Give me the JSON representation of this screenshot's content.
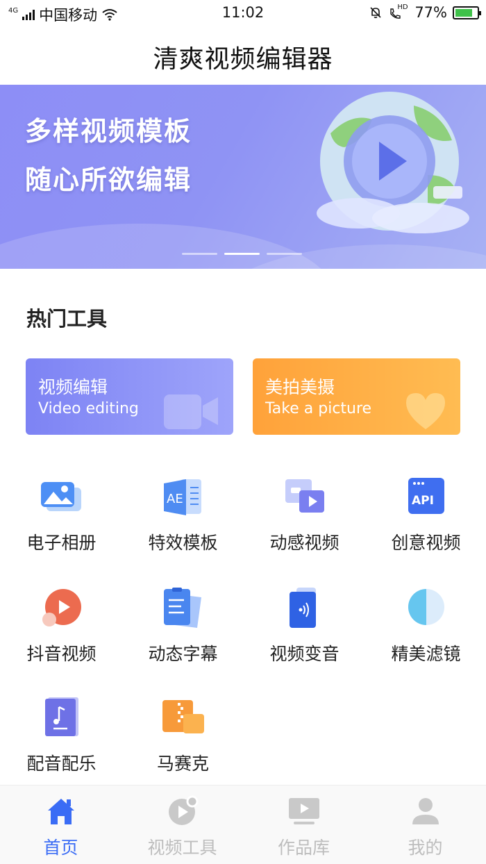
{
  "status_bar": {
    "network": "4G",
    "carrier": "中国移动",
    "time": "11:02",
    "hd": "HD",
    "battery_percent": "77%",
    "battery_level": 0.77
  },
  "app_title": "清爽视频编辑器",
  "banner": {
    "line1": "多样视频模板",
    "line2": "随心所欲编辑",
    "active_slide": 2,
    "slide_count": 3
  },
  "section_title": "热门工具",
  "cards": [
    {
      "title": "视频编辑",
      "subtitle": "Video editing",
      "icon": "video-camera-icon"
    },
    {
      "title": "美拍美摄",
      "subtitle": "Take a picture",
      "icon": "heart-icon"
    }
  ],
  "tools": [
    {
      "label": "电子相册",
      "icon": "photo-album-icon"
    },
    {
      "label": "特效模板",
      "icon": "ae-template-icon"
    },
    {
      "label": "动感视频",
      "icon": "dynamic-video-icon"
    },
    {
      "label": "创意视频",
      "icon": "api-icon"
    },
    {
      "label": "抖音视频",
      "icon": "play-bubble-icon"
    },
    {
      "label": "动态字幕",
      "icon": "subtitle-doc-icon"
    },
    {
      "label": "视频变音",
      "icon": "voice-change-icon"
    },
    {
      "label": "精美滤镜",
      "icon": "filter-icon"
    },
    {
      "label": "配音配乐",
      "icon": "music-note-icon"
    },
    {
      "label": "马赛克",
      "icon": "mosaic-icon"
    }
  ],
  "tabs": [
    {
      "label": "首页",
      "icon": "home-icon",
      "active": true
    },
    {
      "label": "视频工具",
      "icon": "video-tools-icon",
      "active": false
    },
    {
      "label": "作品库",
      "icon": "works-library-icon",
      "active": false
    },
    {
      "label": "我的",
      "icon": "profile-icon",
      "active": false
    }
  ],
  "colors": {
    "accent": "#3a6cf5",
    "banner_purple": "#8d8ef6",
    "card_blue": "#7d83f4",
    "card_orange": "#ffa23a",
    "tab_inactive": "#bdbdbd"
  }
}
